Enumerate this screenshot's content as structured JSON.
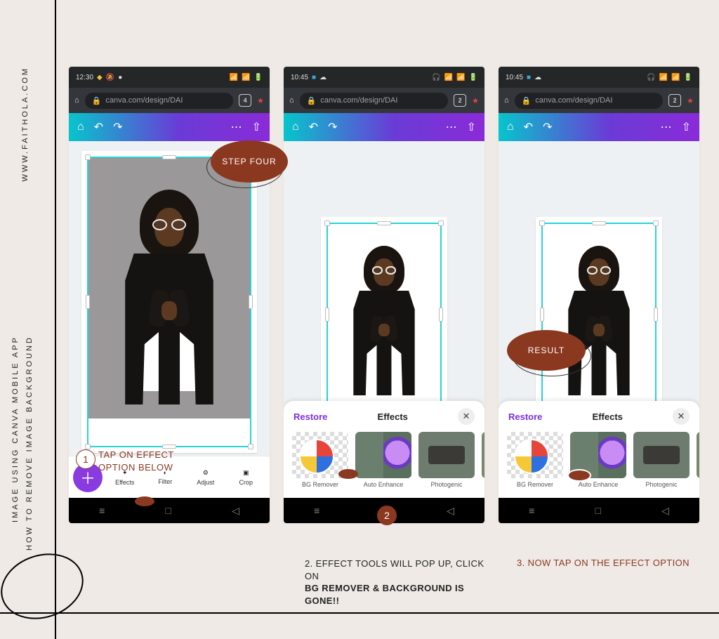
{
  "side": {
    "url": "WWW.FAITHOLA.COM",
    "title_line2": "HOW  TO  REMOVE    IMAGE  BACKGROUND",
    "title_line1": "IMAGE USING CANVA MOBILE   APP"
  },
  "bubbles": {
    "step4": "STEP FOUR",
    "result": "RESULT"
  },
  "nums": {
    "one": "1",
    "two": "2"
  },
  "captions": {
    "tap_effect_l1": "TAP ON EFFECT",
    "tap_effect_l2": "OPTION BELOW",
    "step2_lead": "2. EFFECT TOOLS WILL POP UP, CLICK ON",
    "step2_strong": "BG REMOVER & BACKGROUND IS GONE!!",
    "step3": "3. NOW TAP ON THE EFFECT OPTION"
  },
  "browser": {
    "url_display": "canva.com/design/DAI",
    "tabcount1": "4",
    "tabcount2": "2",
    "tabcount3": "2"
  },
  "status": {
    "time1": "12:30",
    "time2": "10:45",
    "time3": "10:45"
  },
  "tools": {
    "effects": "Effects",
    "filter": "Filter",
    "adjust": "Adjust",
    "crop": "Crop"
  },
  "effects_panel": {
    "restore": "Restore",
    "title": "Effects",
    "items": [
      {
        "label": "BG Remover"
      },
      {
        "label": "Auto Enhance"
      },
      {
        "label": "Photogenic"
      }
    ]
  }
}
